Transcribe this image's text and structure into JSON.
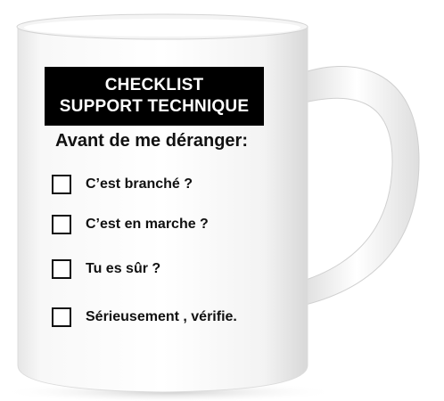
{
  "mug": {
    "body_color": "#ffffff",
    "print_color": "#111111",
    "banner_color": "#000000",
    "banner_text_color": "#ffffff"
  },
  "banner": {
    "line1": "CHECKLIST",
    "line2": "SUPPORT TECHNIQUE"
  },
  "subtitle": "Avant de me déranger:",
  "checklist": [
    {
      "label": "C’est branché ?"
    },
    {
      "label": "C’est en marche ?"
    },
    {
      "label": "Tu es sûr ?"
    },
    {
      "label": "Sérieusement , vérifie."
    }
  ]
}
